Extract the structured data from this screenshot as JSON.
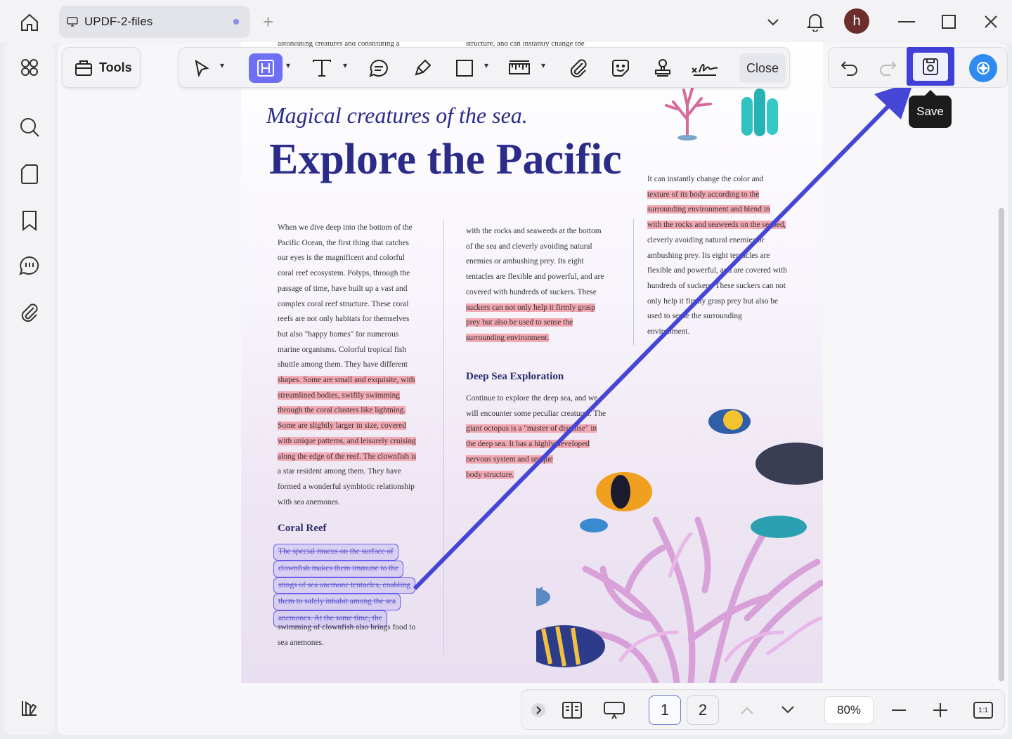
{
  "tab": {
    "title": "UPDF-2-files",
    "new_tab": "+"
  },
  "user": {
    "initial": "h"
  },
  "toolbar": {
    "tools_label": "Tools",
    "close_label": "Close"
  },
  "save": {
    "tooltip": "Save"
  },
  "page": {
    "top_text_left": "astonishing creatures and constituting a",
    "top_text_mid": "structure, and can instantly change the",
    "subtitle": "Magical creatures of the sea.",
    "title": "Explore the Pacific",
    "col1": [
      {
        "t": "When we dive deep into the bottom of the",
        "hl": false
      },
      {
        "t": "Pacific Ocean, the first thing that catches",
        "hl": false
      },
      {
        "t": "our eyes is the magnificent and colorful",
        "hl": false
      },
      {
        "t": "coral reef ecosystem. Polyps, through the",
        "hl": false
      },
      {
        "t": "passage of time, have built up a vast and",
        "hl": false
      },
      {
        "t": "complex coral reef structure. These coral",
        "hl": false
      },
      {
        "t": "reefs are not only habitats for themselves",
        "hl": false
      },
      {
        "t": "but also \"happy homes\" for numerous",
        "hl": false
      },
      {
        "t": "marine organisms. Colorful tropical fish",
        "hl": false
      },
      {
        "t": "shuttle among them. They have different",
        "hl": false
      },
      {
        "t": "shapes. Some are small and exquisite, with",
        "hl": true
      },
      {
        "t": "streamlined bodies, swiftly swimming",
        "hl": true
      },
      {
        "t": "through the coral clusters like lightning.",
        "hl": true
      },
      {
        "t": "Some are slightly larger in size, covered",
        "hl": true
      },
      {
        "t": "with unique patterns, and leisurely cruising",
        "hl": true
      },
      {
        "t": "along the edge of the reef. The clownfish is",
        "hl": true
      },
      {
        "t": "a star resident among them. They have",
        "hl": false
      },
      {
        "t": "formed a wonderful symbiotic relationship",
        "hl": false
      },
      {
        "t": "with sea anemones.",
        "hl": false
      }
    ],
    "coral_heading": "Coral Reef",
    "coral_selected": [
      "The special mucus on the surface of",
      "clownfish makes them immune to the",
      "stings of sea anemone tentacles, enabling",
      "them to safely inhabit among the sea",
      "anemones. At the same time, the"
    ],
    "coral_rest": [
      "swimming of clownfish also brings food to",
      "sea anemones."
    ],
    "col2": [
      {
        "t": "with the rocks and seaweeds at the bottom",
        "hl": false
      },
      {
        "t": "of the sea and cleverly avoiding natural",
        "hl": false
      },
      {
        "t": "enemies or ambushing prey. Its eight",
        "hl": false
      },
      {
        "t": "tentacles are flexible and powerful, and are",
        "hl": false
      },
      {
        "t": "covered with hundreds of suckers. These",
        "hl": false
      },
      {
        "t": "suckers can not only help it firmly grasp",
        "hl": true
      },
      {
        "t": "prey but also be used to sense the",
        "hl": true
      },
      {
        "t": "surrounding environment.",
        "hl": true
      }
    ],
    "deep_heading": "Deep Sea Exploration",
    "col2b": [
      {
        "t": "Continue to explore the deep sea, and we",
        "hl": false
      },
      {
        "t": "will encounter some peculiar creatures. The",
        "hl": false
      },
      {
        "t": "giant octopus is a \"master of disguise\" in",
        "hl": true
      },
      {
        "t": "the deep sea. It has a highly developed",
        "hl": true
      },
      {
        "t": "nervous system and unique",
        "hl": true
      },
      {
        "t": "body structure.",
        "hl": true
      }
    ],
    "col3": [
      {
        "t": "It can instantly change the color and",
        "hl": false
      },
      {
        "t": "texture of its body according to the",
        "hl": true
      },
      {
        "t": "surrounding environment and blend in",
        "hl": true
      },
      {
        "t": "with the rocks and seaweeds on the seabed,",
        "hl": true
      },
      {
        "t": "cleverly avoiding natural enemies or",
        "hl": false
      },
      {
        "t": "ambushing prey. Its eight tentacles are",
        "hl": false
      },
      {
        "t": "flexible and powerful, and are covered with",
        "hl": false
      },
      {
        "t": "hundreds of suckers. These suckers can not",
        "hl": false
      },
      {
        "t": "only help it firmly grasp prey but also be",
        "hl": false
      },
      {
        "t": "used to sense the surrounding",
        "hl": false
      },
      {
        "t": "environment.",
        "hl": false
      }
    ]
  },
  "bottom": {
    "page1": "1",
    "page2": "2",
    "zoom": "80%",
    "fit": "1:1"
  },
  "colors": {
    "accent": "#4040d8",
    "highlight": "#f3a9b4",
    "heading": "#2b2b8a"
  }
}
